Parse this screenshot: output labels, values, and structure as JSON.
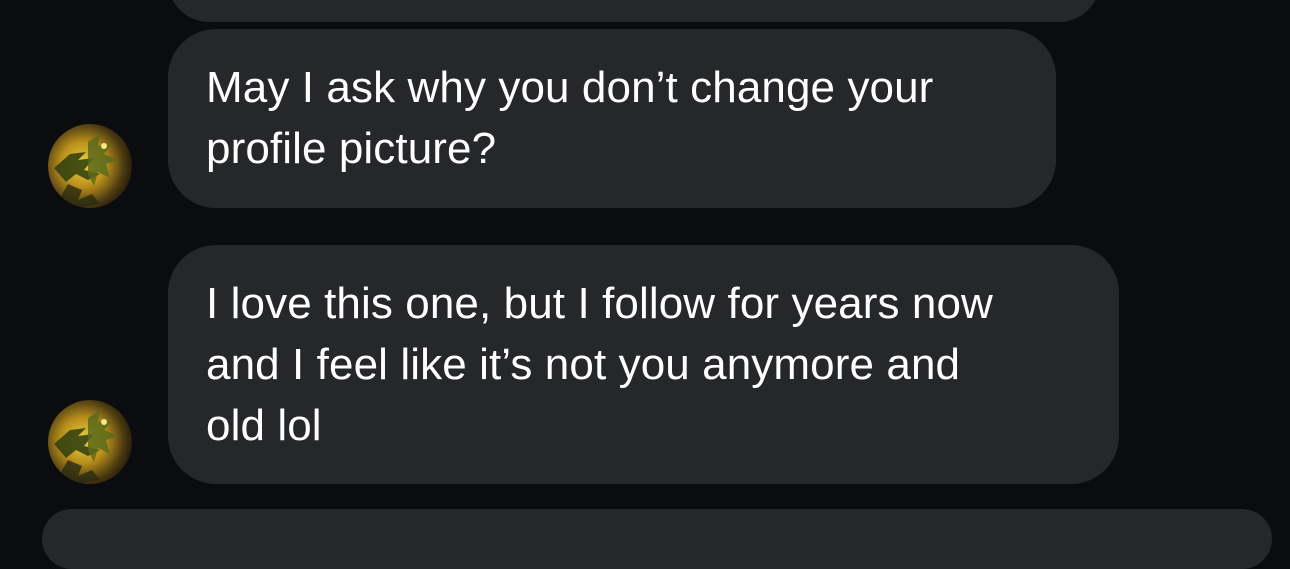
{
  "messages": [
    {
      "sender": "other",
      "lines": [
        "May I ask why you don’t change your",
        "profile picture?"
      ]
    },
    {
      "sender": "other",
      "lines": [
        "I love this one, but I follow for years now",
        "and I feel like it’s not you anymore and",
        "old lol"
      ]
    }
  ],
  "avatar_icon": "dragon-avatar-icon",
  "colors": {
    "background": "#0b0c10",
    "bubble": "#26272b",
    "text": "#ffffff"
  }
}
